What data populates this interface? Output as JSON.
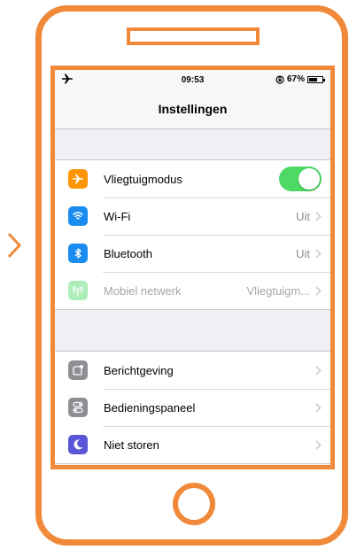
{
  "colors": {
    "frame": "#f08a3a",
    "toggle_on": "#4cd964",
    "airplane_icon_bg": "#ff9500",
    "wifi_icon_bg": "#1a8cf0",
    "bluetooth_icon_bg": "#1a8cf0",
    "cellular_icon_bg": "#4cd964",
    "notifications_icon_bg": "#8e8e93",
    "control_center_icon_bg": "#8e8e93",
    "do_not_disturb_icon_bg": "#5856d6"
  },
  "status_bar": {
    "time": "09:53",
    "battery": "67%",
    "battery_level": 0.67,
    "left_icon": "airplane-icon",
    "right_icons": [
      "rotation-lock-icon",
      "battery-icon"
    ]
  },
  "nav": {
    "title": "Instellingen"
  },
  "groups": [
    {
      "items": [
        {
          "label": "Vliegtuigmodus",
          "icon": "airplane-icon",
          "toggle": true,
          "toggle_on": true
        },
        {
          "label": "Wi-Fi",
          "icon": "wifi-icon",
          "value": "Uit"
        },
        {
          "label": "Bluetooth",
          "icon": "bluetooth-icon",
          "value": "Uit"
        },
        {
          "label": "Mobiel netwerk",
          "icon": "cellular-icon",
          "value": "Vliegtuigm...",
          "disabled": true
        }
      ]
    },
    {
      "items": [
        {
          "label": "Berichtgeving",
          "icon": "notifications-icon"
        },
        {
          "label": "Bedieningspaneel",
          "icon": "control-center-icon"
        },
        {
          "label": "Niet storen",
          "icon": "moon-icon"
        }
      ]
    }
  ]
}
